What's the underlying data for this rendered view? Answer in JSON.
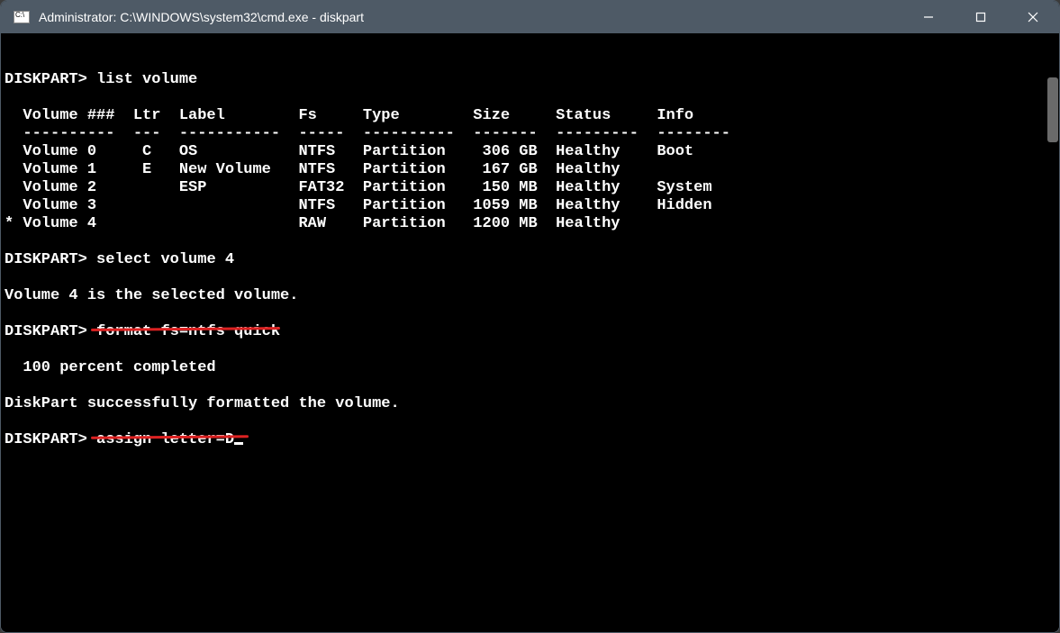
{
  "window": {
    "title": "Administrator: C:\\WINDOWS\\system32\\cmd.exe - diskpart"
  },
  "prompt": "DISKPART>",
  "cmds": {
    "list_volume": "list volume",
    "select_volume": "select volume 4",
    "format_cmd": "format fs=ntfs quick",
    "assign_cmd": "assign letter=D"
  },
  "responses": {
    "selected": "Volume 4 is the selected volume.",
    "percent": "  100 percent completed",
    "formatted": "DiskPart successfully formatted the volume."
  },
  "table": {
    "header": "  Volume ###  Ltr  Label        Fs     Type        Size     Status     Info",
    "divider": "  ----------  ---  -----------  -----  ----------  -------  ---------  --------",
    "rows": [
      "  Volume 0     C   OS           NTFS   Partition    306 GB  Healthy    Boot",
      "  Volume 1     E   New Volume   NTFS   Partition    167 GB  Healthy",
      "  Volume 2         ESP          FAT32  Partition    150 MB  Healthy    System",
      "  Volume 3                      NTFS   Partition   1059 MB  Healthy    Hidden",
      "* Volume 4                      RAW    Partition   1200 MB  Healthy"
    ]
  },
  "annotations": {
    "underline1_cmd": "format fs=ntfs quick",
    "underline2_cmd": "assign letter=D"
  },
  "chart_data": {
    "type": "table",
    "columns": [
      "Volume ###",
      "Ltr",
      "Label",
      "Fs",
      "Type",
      "Size",
      "Status",
      "Info"
    ],
    "rows": [
      {
        "selected": false,
        "volume": "Volume 0",
        "ltr": "C",
        "label": "OS",
        "fs": "NTFS",
        "type": "Partition",
        "size": "306 GB",
        "status": "Healthy",
        "info": "Boot"
      },
      {
        "selected": false,
        "volume": "Volume 1",
        "ltr": "E",
        "label": "New Volume",
        "fs": "NTFS",
        "type": "Partition",
        "size": "167 GB",
        "status": "Healthy",
        "info": ""
      },
      {
        "selected": false,
        "volume": "Volume 2",
        "ltr": "",
        "label": "ESP",
        "fs": "FAT32",
        "type": "Partition",
        "size": "150 MB",
        "status": "Healthy",
        "info": "System"
      },
      {
        "selected": false,
        "volume": "Volume 3",
        "ltr": "",
        "label": "",
        "fs": "NTFS",
        "type": "Partition",
        "size": "1059 MB",
        "status": "Healthy",
        "info": "Hidden"
      },
      {
        "selected": true,
        "volume": "Volume 4",
        "ltr": "",
        "label": "",
        "fs": "RAW",
        "type": "Partition",
        "size": "1200 MB",
        "status": "Healthy",
        "info": ""
      }
    ]
  }
}
